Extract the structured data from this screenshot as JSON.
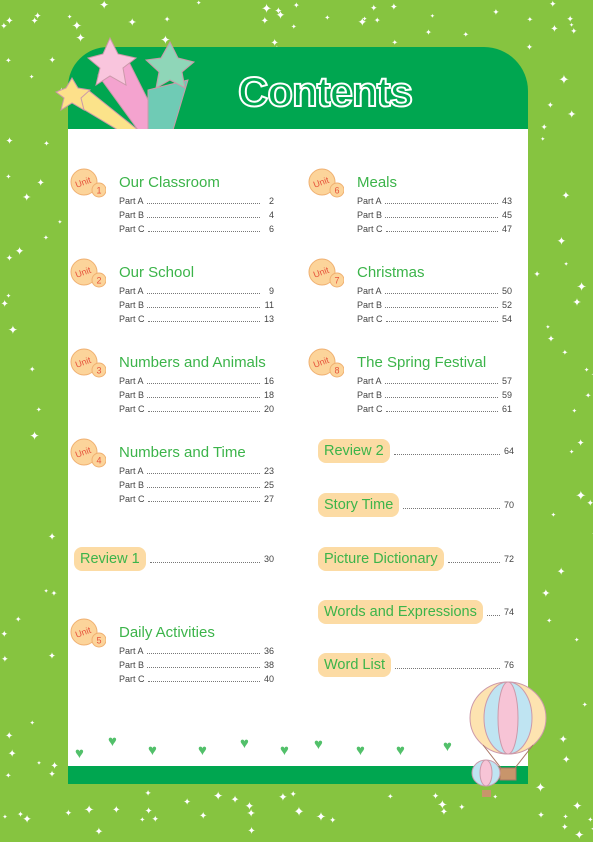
{
  "title": "Contents",
  "unit_badge_label": "Unit",
  "units": [
    {
      "number": "1",
      "title": "Our Classroom",
      "parts": [
        {
          "label": "Part A",
          "page": "2"
        },
        {
          "label": "Part B",
          "page": "4"
        },
        {
          "label": "Part C",
          "page": "6"
        }
      ]
    },
    {
      "number": "2",
      "title": "Our School",
      "parts": [
        {
          "label": "Part A",
          "page": "9"
        },
        {
          "label": "Part B",
          "page": "11"
        },
        {
          "label": "Part C",
          "page": "13"
        }
      ]
    },
    {
      "number": "3",
      "title": "Numbers and Animals",
      "parts": [
        {
          "label": "Part A",
          "page": "16"
        },
        {
          "label": "Part B",
          "page": "18"
        },
        {
          "label": "Part C",
          "page": "20"
        }
      ]
    },
    {
      "number": "4",
      "title": "Numbers and Time",
      "parts": [
        {
          "label": "Part A",
          "page": "23"
        },
        {
          "label": "Part B",
          "page": "25"
        },
        {
          "label": "Part C",
          "page": "27"
        }
      ]
    },
    {
      "number": "5",
      "title": "Daily Activities",
      "parts": [
        {
          "label": "Part A",
          "page": "36"
        },
        {
          "label": "Part B",
          "page": "38"
        },
        {
          "label": "Part C",
          "page": "40"
        }
      ]
    },
    {
      "number": "6",
      "title": "Meals",
      "parts": [
        {
          "label": "Part A",
          "page": "43"
        },
        {
          "label": "Part B",
          "page": "45"
        },
        {
          "label": "Part C",
          "page": "47"
        }
      ]
    },
    {
      "number": "7",
      "title": "Christmas",
      "parts": [
        {
          "label": "Part A",
          "page": "50"
        },
        {
          "label": "Part B",
          "page": "52"
        },
        {
          "label": "Part C",
          "page": "54"
        }
      ]
    },
    {
      "number": "8",
      "title": "The Spring Festival",
      "parts": [
        {
          "label": "Part A",
          "page": "57"
        },
        {
          "label": "Part B",
          "page": "59"
        },
        {
          "label": "Part C",
          "page": "61"
        }
      ]
    }
  ],
  "sections": [
    {
      "title": "Review 1",
      "page": "30"
    },
    {
      "title": "Review 2",
      "page": "64"
    },
    {
      "title": "Story Time",
      "page": "70"
    },
    {
      "title": "Picture Dictionary",
      "page": "72"
    },
    {
      "title": "Words and Expressions",
      "page": "74"
    },
    {
      "title": "Word List",
      "page": "76"
    }
  ],
  "colors": {
    "background": "#86c440",
    "header": "#00a650",
    "title_text": "#3cb44a",
    "pill": "#fcdba4"
  }
}
